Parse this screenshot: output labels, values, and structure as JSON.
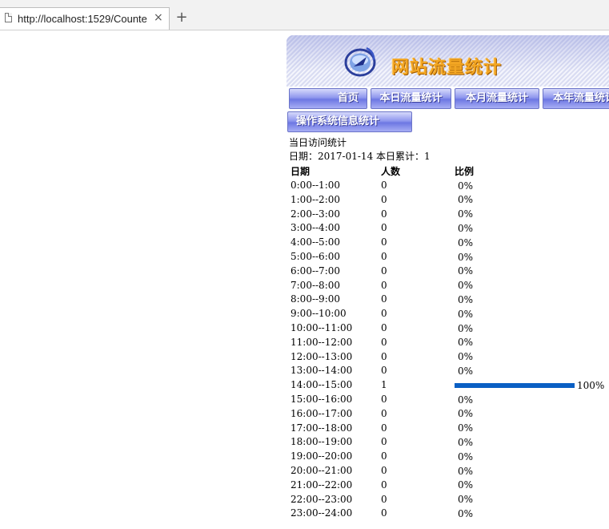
{
  "browser": {
    "tab_title": "http://localhost:1529/Counte",
    "close_glyph": "×",
    "new_tab_glyph": "+"
  },
  "banner": {
    "title": "网站流量统计"
  },
  "nav": {
    "home": "首页",
    "day": "本日流量统计",
    "month": "本月流量统计",
    "year": "本年流量统计",
    "os": "操作系统信息统计"
  },
  "section_title": "当日访问统计",
  "summary": {
    "date_label": "日期：",
    "date": "2017-01-14",
    "total_label": "本日累计：",
    "total": "1"
  },
  "table": {
    "headers": [
      "日期",
      "人数",
      "比例"
    ],
    "rows": [
      {
        "time": "0:00--1:00",
        "count": "0",
        "percent": "0%",
        "ratio": 0
      },
      {
        "time": "1:00--2:00",
        "count": "0",
        "percent": "0%",
        "ratio": 0
      },
      {
        "time": "2:00--3:00",
        "count": "0",
        "percent": "0%",
        "ratio": 0
      },
      {
        "time": "3:00--4:00",
        "count": "0",
        "percent": "0%",
        "ratio": 0
      },
      {
        "time": "4:00--5:00",
        "count": "0",
        "percent": "0%",
        "ratio": 0
      },
      {
        "time": "5:00--6:00",
        "count": "0",
        "percent": "0%",
        "ratio": 0
      },
      {
        "time": "6:00--7:00",
        "count": "0",
        "percent": "0%",
        "ratio": 0
      },
      {
        "time": "7:00--8:00",
        "count": "0",
        "percent": "0%",
        "ratio": 0
      },
      {
        "time": "8:00--9:00",
        "count": "0",
        "percent": "0%",
        "ratio": 0
      },
      {
        "time": "9:00--10:00",
        "count": "0",
        "percent": "0%",
        "ratio": 0
      },
      {
        "time": "10:00--11:00",
        "count": "0",
        "percent": "0%",
        "ratio": 0
      },
      {
        "time": "11:00--12:00",
        "count": "0",
        "percent": "0%",
        "ratio": 0
      },
      {
        "time": "12:00--13:00",
        "count": "0",
        "percent": "0%",
        "ratio": 0
      },
      {
        "time": "13:00--14:00",
        "count": "0",
        "percent": "0%",
        "ratio": 0
      },
      {
        "time": "14:00--15:00",
        "count": "1",
        "percent": "100%",
        "ratio": 1
      },
      {
        "time": "15:00--16:00",
        "count": "0",
        "percent": "0%",
        "ratio": 0
      },
      {
        "time": "16:00--17:00",
        "count": "0",
        "percent": "0%",
        "ratio": 0
      },
      {
        "time": "17:00--18:00",
        "count": "0",
        "percent": "0%",
        "ratio": 0
      },
      {
        "time": "18:00--19:00",
        "count": "0",
        "percent": "0%",
        "ratio": 0
      },
      {
        "time": "19:00--20:00",
        "count": "0",
        "percent": "0%",
        "ratio": 0
      },
      {
        "time": "20:00--21:00",
        "count": "0",
        "percent": "0%",
        "ratio": 0
      },
      {
        "time": "21:00--22:00",
        "count": "0",
        "percent": "0%",
        "ratio": 0
      },
      {
        "time": "22:00--23:00",
        "count": "0",
        "percent": "0%",
        "ratio": 0
      },
      {
        "time": "23:00--24:00",
        "count": "0",
        "percent": "0%",
        "ratio": 0
      }
    ]
  },
  "colors": {
    "bar": "#0a5fc4",
    "banner_title": "#f3a623",
    "nav_button": "#7b84e8"
  }
}
